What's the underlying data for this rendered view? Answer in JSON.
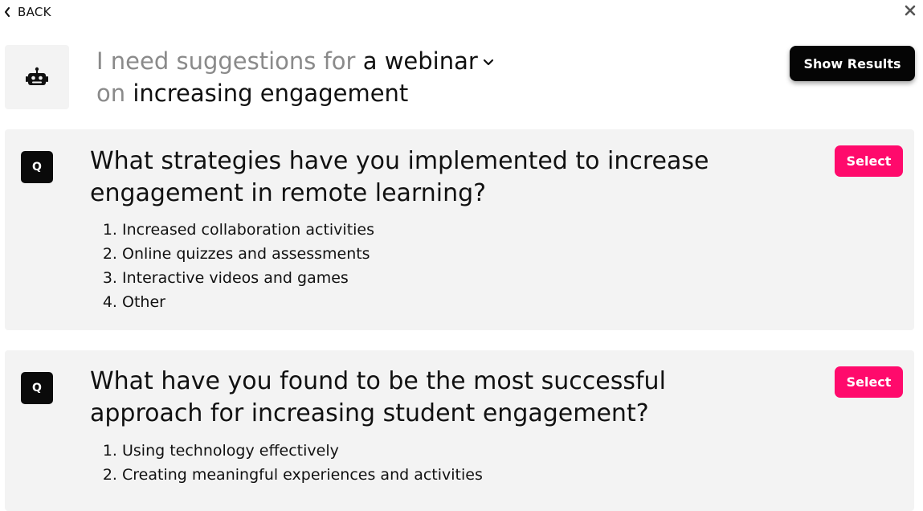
{
  "nav": {
    "back_label": "BACK",
    "back_icon": "chevron-left-icon",
    "close_icon": "close-icon"
  },
  "prompt": {
    "prefix": "I need suggestions for",
    "type_value": "a webinar",
    "line2_prefix": "on",
    "topic": "increasing engagement",
    "avatar_icon": "robot-icon"
  },
  "actions": {
    "show_results_label": "Show Results"
  },
  "questions": [
    {
      "badge": "Q",
      "text": "What strategies have you implemented to increase engagement in remote learning?",
      "select_label": "Select",
      "options": [
        "Increased collaboration activities",
        "Online quizzes and assessments",
        "Interactive videos and games",
        "Other"
      ]
    },
    {
      "badge": "Q",
      "text": "What have you found to be the most successful approach for increasing student engagement?",
      "select_label": "Select",
      "options": [
        "Using technology effectively",
        "Creating meaningful experiences and activities"
      ]
    }
  ],
  "colors": {
    "accent": "#ff0a6c",
    "dark": "#050505",
    "card_bg": "#f3f3f3",
    "muted_text": "#8a8a8a"
  }
}
